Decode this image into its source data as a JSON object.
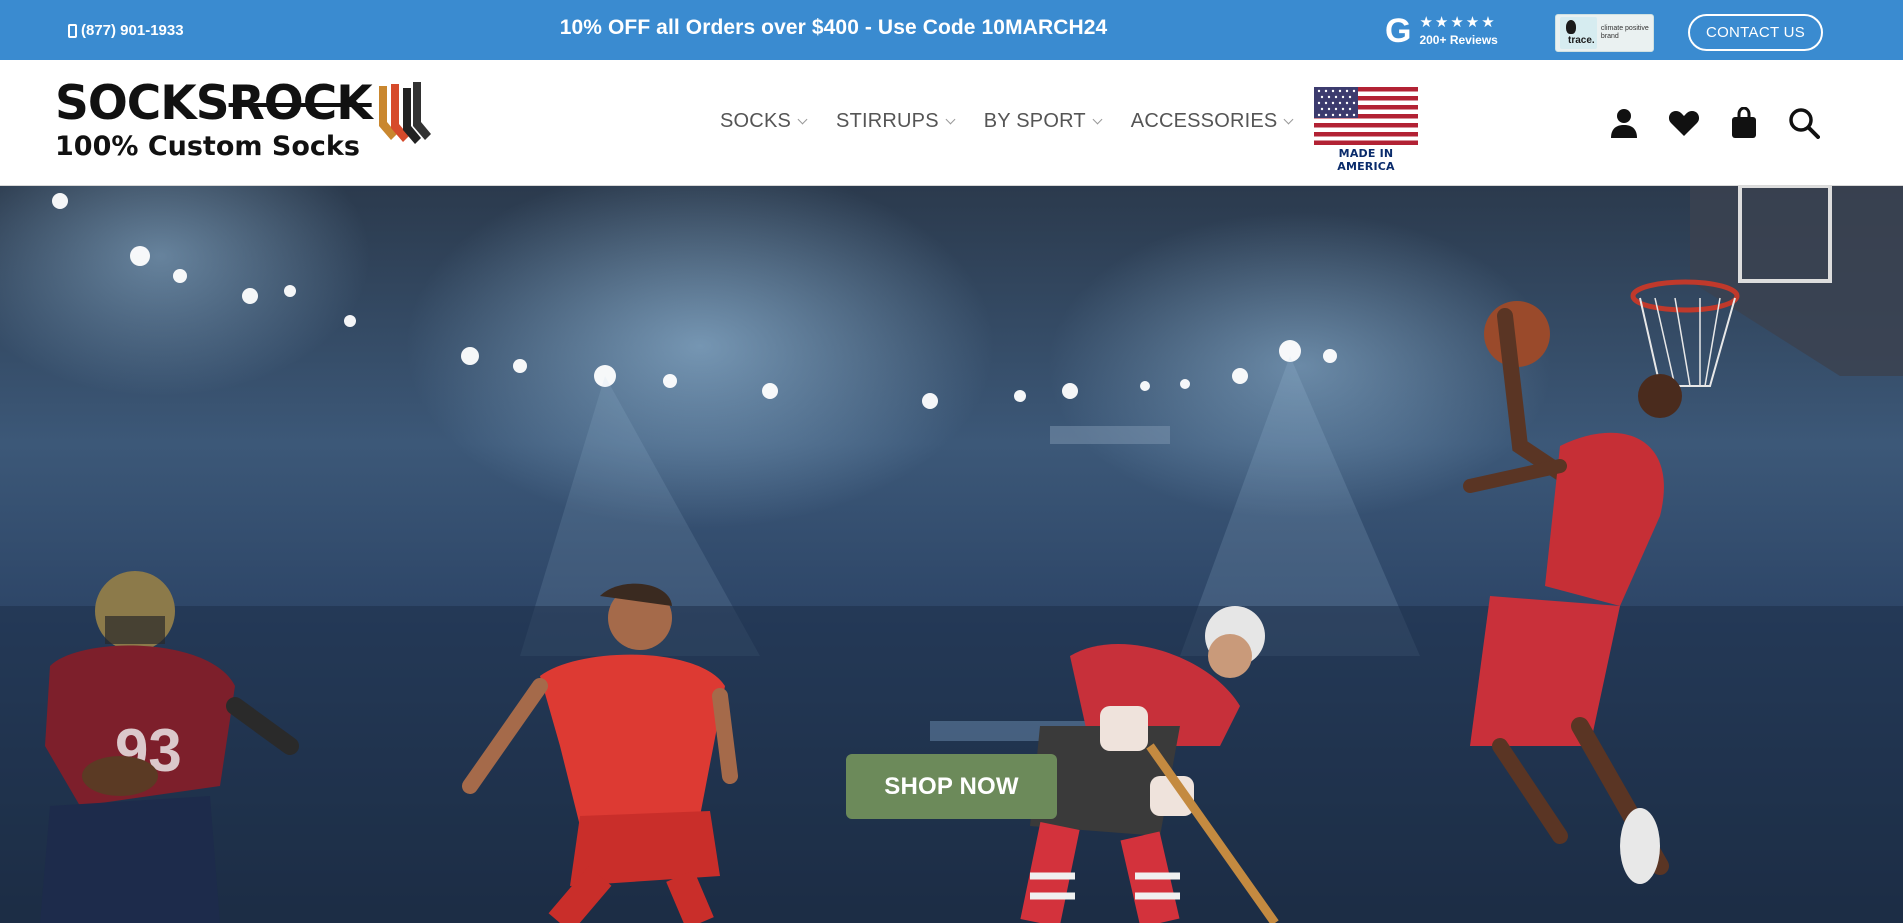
{
  "topbar": {
    "phone": "(877) 901-1933",
    "promo": "10% OFF all Orders over $400 - Use Code 10MARCH24",
    "google": {
      "letter": "G",
      "stars": "★★★★★",
      "reviews": "200+ Reviews"
    },
    "trace_badge": {
      "word": "trace.",
      "text": "climate positive brand"
    },
    "contact_label": "CONTACT US"
  },
  "header": {
    "logo": {
      "part1": "SOCKS",
      "part2": "ROCK",
      "tagline": "100% Custom Socks"
    },
    "nav": [
      {
        "label": "SOCKS"
      },
      {
        "label": "STIRRUPS"
      },
      {
        "label": "BY SPORT"
      },
      {
        "label": "ACCESSORIES"
      }
    ],
    "flag_label": "MADE IN AMERICA",
    "icons": [
      "user-icon",
      "heart-icon",
      "bag-icon",
      "search-icon"
    ]
  },
  "hero": {
    "cta_label": "SHOP NOW"
  },
  "colors": {
    "topbar_bg": "#3a8bd0",
    "cta_bg": "#6c8a5a",
    "nav_text": "#555555"
  }
}
